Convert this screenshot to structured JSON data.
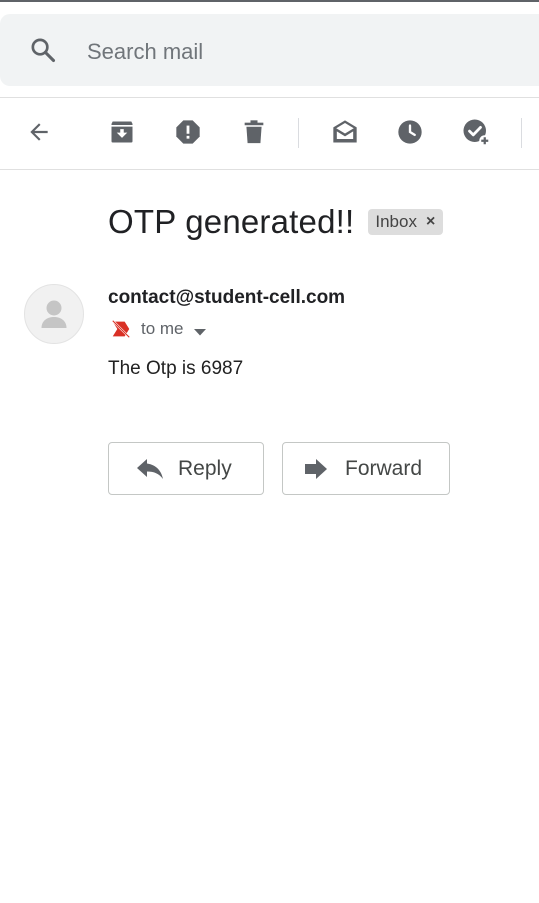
{
  "search": {
    "placeholder": "Search mail"
  },
  "toolbar": {
    "icons": [
      "back-arrow-icon",
      "archive-icon",
      "report-spam-icon",
      "delete-icon",
      "mark-unread-icon",
      "snooze-icon",
      "add-to-tasks-icon"
    ]
  },
  "message": {
    "subject": "OTP generated!!",
    "label": "Inbox",
    "label_remove": "×",
    "sender": "contact@student-cell.com",
    "recipient": "to me",
    "body": "The Otp is 6987"
  },
  "actions": {
    "reply_label": "Reply",
    "forward_label": "Forward"
  },
  "colors": {
    "icon_gray": "#5f6368",
    "search_bg": "#f1f3f4",
    "chip_bg": "#dddddd",
    "important_red": "#d93025"
  }
}
